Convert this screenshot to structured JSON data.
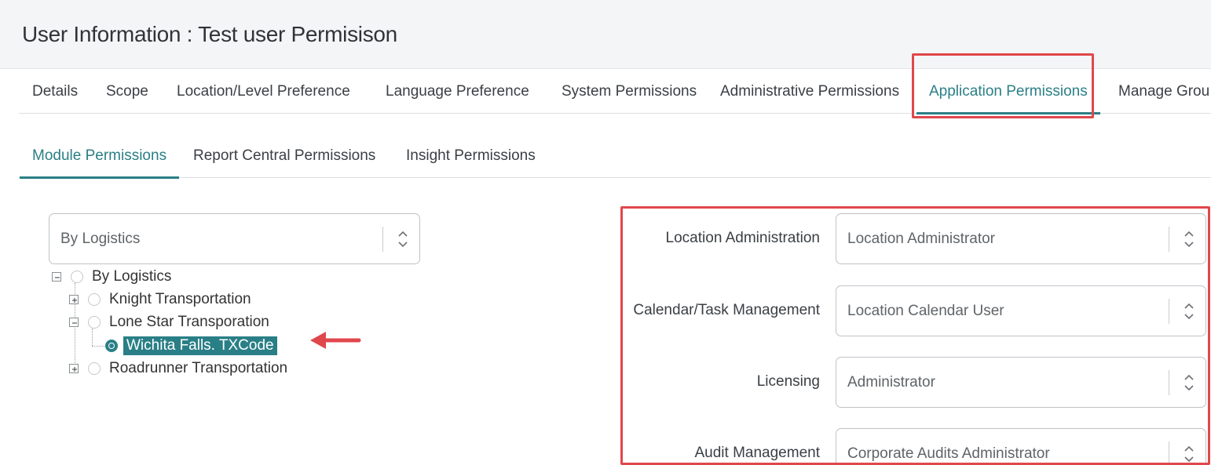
{
  "header": {
    "title": "User Information : Test user Permisison"
  },
  "main_tabs": [
    {
      "label": "Details"
    },
    {
      "label": "Scope"
    },
    {
      "label": "Location/Level Preference"
    },
    {
      "label": "Language Preference"
    },
    {
      "label": "System Permissions"
    },
    {
      "label": "Administrative Permissions"
    },
    {
      "label": "Application Permissions",
      "active": true
    },
    {
      "label": "Manage Grou"
    }
  ],
  "sub_tabs": [
    {
      "label": "Module Permissions",
      "active": true
    },
    {
      "label": "Report Central Permissions"
    },
    {
      "label": "Insight Permissions"
    }
  ],
  "hierarchy_select": {
    "value": "By Logistics"
  },
  "tree": {
    "root": "By Logistics",
    "children": [
      {
        "label": "Knight Transportation"
      },
      {
        "label": "Lone Star Transporation",
        "children": [
          {
            "label": "Wichita Falls. TXCode",
            "selected": true
          }
        ]
      },
      {
        "label": "Roadrunner Transportation"
      }
    ]
  },
  "fields": [
    {
      "label": "Location Administration",
      "value": "Location Administrator"
    },
    {
      "label": "Calendar/Task Management",
      "value": "Location Calendar User"
    },
    {
      "label": "Licensing",
      "value": "Administrator"
    },
    {
      "label": "Audit Management",
      "value": "Corporate Audits Administrator"
    }
  ],
  "colors": {
    "accent": "#2a7f86",
    "highlight": "#e0474c",
    "arrow": "#e0474c"
  }
}
